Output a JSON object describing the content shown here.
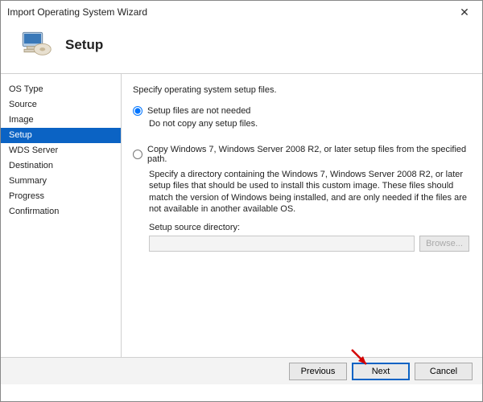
{
  "window": {
    "title": "Import Operating System Wizard"
  },
  "header": {
    "page_title": "Setup"
  },
  "sidebar": {
    "items": [
      {
        "label": "OS Type"
      },
      {
        "label": "Source"
      },
      {
        "label": "Image"
      },
      {
        "label": "Setup",
        "selected": true
      },
      {
        "label": "WDS Server"
      },
      {
        "label": "Destination"
      },
      {
        "label": "Summary"
      },
      {
        "label": "Progress"
      },
      {
        "label": "Confirmation"
      }
    ]
  },
  "main": {
    "instruction": "Specify operating system setup files.",
    "option_a": {
      "label": "Setup files are not needed",
      "subtext": "Do not copy any setup files.",
      "checked": true
    },
    "option_b": {
      "label": "Copy Windows 7, Windows Server 2008 R2, or later setup files from the specified path.",
      "description": "Specify a directory containing the Windows 7, Windows Server 2008 R2, or later setup files that should be used to install this custom image.  These files should match the version of Windows being installed, and are only needed if the files are not available in another available OS.",
      "dir_label": "Setup source directory:",
      "dir_value": "",
      "browse_label": "Browse...",
      "checked": false
    }
  },
  "footer": {
    "previous": "Previous",
    "next": "Next",
    "cancel": "Cancel"
  }
}
